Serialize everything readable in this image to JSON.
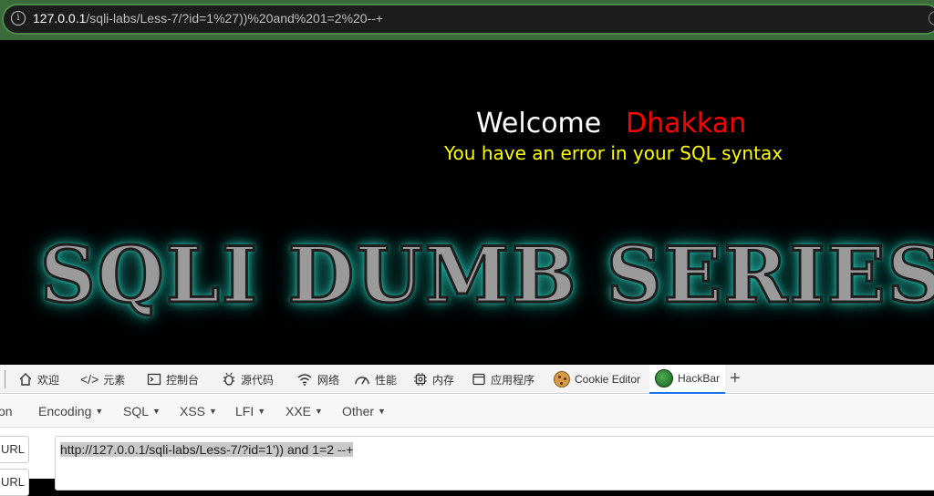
{
  "browser": {
    "url_host": "127.0.0.1",
    "url_path": "/sqli-labs/Less-7/?id=1%27))%20and%201=2%20--+"
  },
  "page": {
    "welcome": "Welcome",
    "user_name": "Dhakkan",
    "error_message": "You have an error in your SQL syntax",
    "banner": "SQLI DUMB SERIES"
  },
  "devtools": {
    "tabs": [
      {
        "label": "欢迎",
        "icon": "home-icon"
      },
      {
        "label": "元素",
        "icon": "code-icon"
      },
      {
        "label": "控制台",
        "icon": "console-icon"
      },
      {
        "label": "源代码",
        "icon": "bug-icon"
      },
      {
        "label": "网络",
        "icon": "wifi-icon"
      },
      {
        "label": "性能",
        "icon": "gauge-icon"
      },
      {
        "label": "内存",
        "icon": "chip-icon"
      },
      {
        "label": "应用程序",
        "icon": "window-icon"
      },
      {
        "label": "Cookie Editor",
        "icon": "cookie-icon"
      },
      {
        "label": "HackBar",
        "icon": "hackbar-logo-icon"
      }
    ],
    "active_tab": "HackBar"
  },
  "hackbar": {
    "menu": [
      {
        "label": "on"
      },
      {
        "label": "Encoding"
      },
      {
        "label": "SQL"
      },
      {
        "label": "XSS"
      },
      {
        "label": "LFI"
      },
      {
        "label": "XXE"
      },
      {
        "label": "Other"
      }
    ],
    "side_buttons": [
      "URL",
      "URL"
    ],
    "url_value": "http://127.0.0.1/sqli-labs/Less-7/?id=1')) and 1=2 --+"
  }
}
